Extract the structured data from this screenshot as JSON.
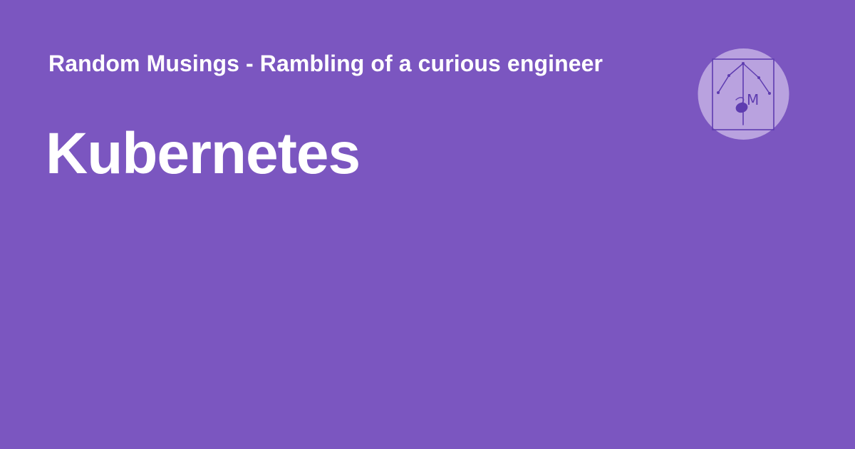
{
  "site": {
    "title": "Random Musings - Rambling of a curious engineer"
  },
  "page": {
    "title": "Kubernetes"
  },
  "logo": {
    "icon": "random-musings-logo-icon",
    "monogram": "M"
  },
  "colors": {
    "background": "#7b56c0",
    "text": "#ffffff",
    "logo_circle": "#b9a2df",
    "logo_line": "#5e3cb0"
  }
}
